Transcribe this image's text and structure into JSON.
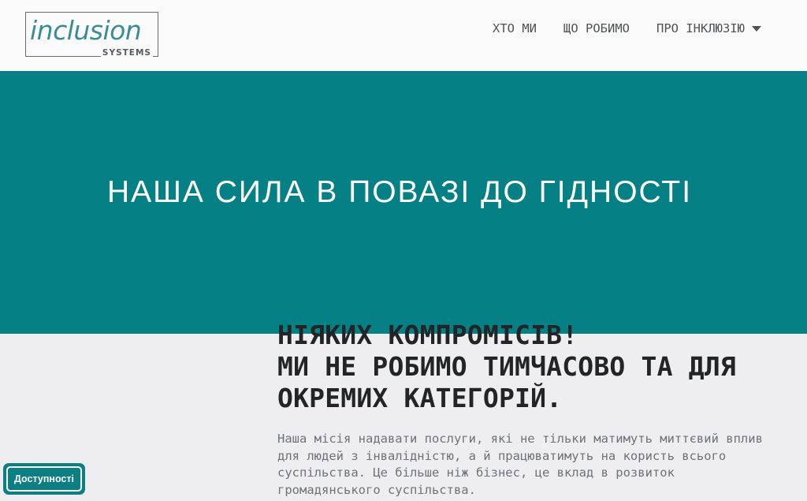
{
  "header": {
    "logo": {
      "word": "inclusion",
      "sub": "SYSTEMS"
    },
    "nav": [
      {
        "label": "ХТО МИ"
      },
      {
        "label": "ЩО РОБИМО"
      },
      {
        "label": "ПРО ІНКЛЮЗІЮ",
        "has_dropdown": true
      }
    ]
  },
  "hero": {
    "title": "НАША СИЛА В ПОВАЗІ ДО ГІДНОСТІ",
    "background": "#058084"
  },
  "content": {
    "heading_line1": "НІЯКИХ КОМПРОМІСІВ!",
    "heading_line2": "МИ НЕ РОБИМО ТИМЧАСОВО ТА ДЛЯ ОКРЕМИХ КАТЕГОРІЙ.",
    "paragraph": "Наша місія надавати послуги, які не тільки матимуть миттєвий вплив для людей з інвалідністю, а й працюватимуть на користь всього суспільства. Це більше ніж бізнес, це вклад в розвиток громадянського суспільства."
  },
  "accessibility": {
    "label": "Доступності"
  },
  "colors": {
    "accent": "#058084",
    "page_bg": "#eeeef0",
    "header_bg": "#fafafa"
  }
}
